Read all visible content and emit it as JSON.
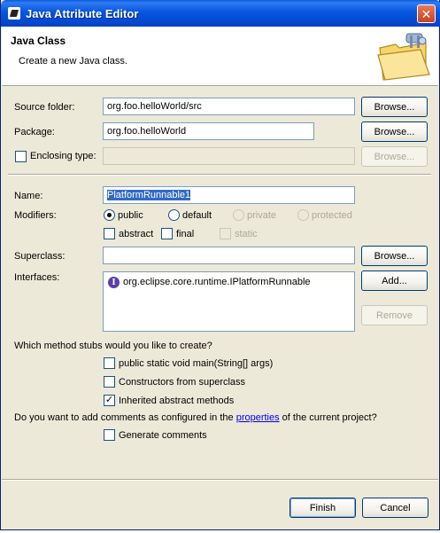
{
  "window": {
    "title": "Java Attribute Editor",
    "close_glyph": "✕"
  },
  "header": {
    "title": "Java Class",
    "description": "Create a new Java class.",
    "icon": "folder-icon"
  },
  "fields": {
    "source_folder_label": "Source folder:",
    "source_folder_value": "org.foo.helloWorld/src",
    "package_label": "Package:",
    "package_value": "org.foo.helloWorld",
    "enclosing_label": "Enclosing type:",
    "enclosing_value": "",
    "name_label": "Name:",
    "name_value": "PlatformRunnable1",
    "modifiers_label": "Modifiers:",
    "superclass_label": "Superclass:",
    "superclass_value": "",
    "interfaces_label": "Interfaces:"
  },
  "buttons": {
    "browse": "Browse...",
    "add": "Add...",
    "remove": "Remove",
    "finish": "Finish",
    "cancel": "Cancel"
  },
  "modifiers": {
    "public": "public",
    "default": "default",
    "private": "private",
    "protected": "protected",
    "abstract": "abstract",
    "final": "final",
    "static": "static",
    "selected": "public"
  },
  "interfaces": [
    "org.eclipse.core.runtime.IPlatformRunnable"
  ],
  "stubs": {
    "question": "Which method stubs would you like to create?",
    "main": "public static void main(String[] args)",
    "constructors": "Constructors from superclass",
    "inherited": "Inherited abstract methods",
    "main_checked": false,
    "constructors_checked": false,
    "inherited_checked": true
  },
  "comments": {
    "question_prefix": "Do you want to add comments as configured in the ",
    "link": "properties",
    "question_suffix": " of the current project?",
    "generate": "Generate comments",
    "generate_checked": false
  },
  "check_glyph": "✓"
}
